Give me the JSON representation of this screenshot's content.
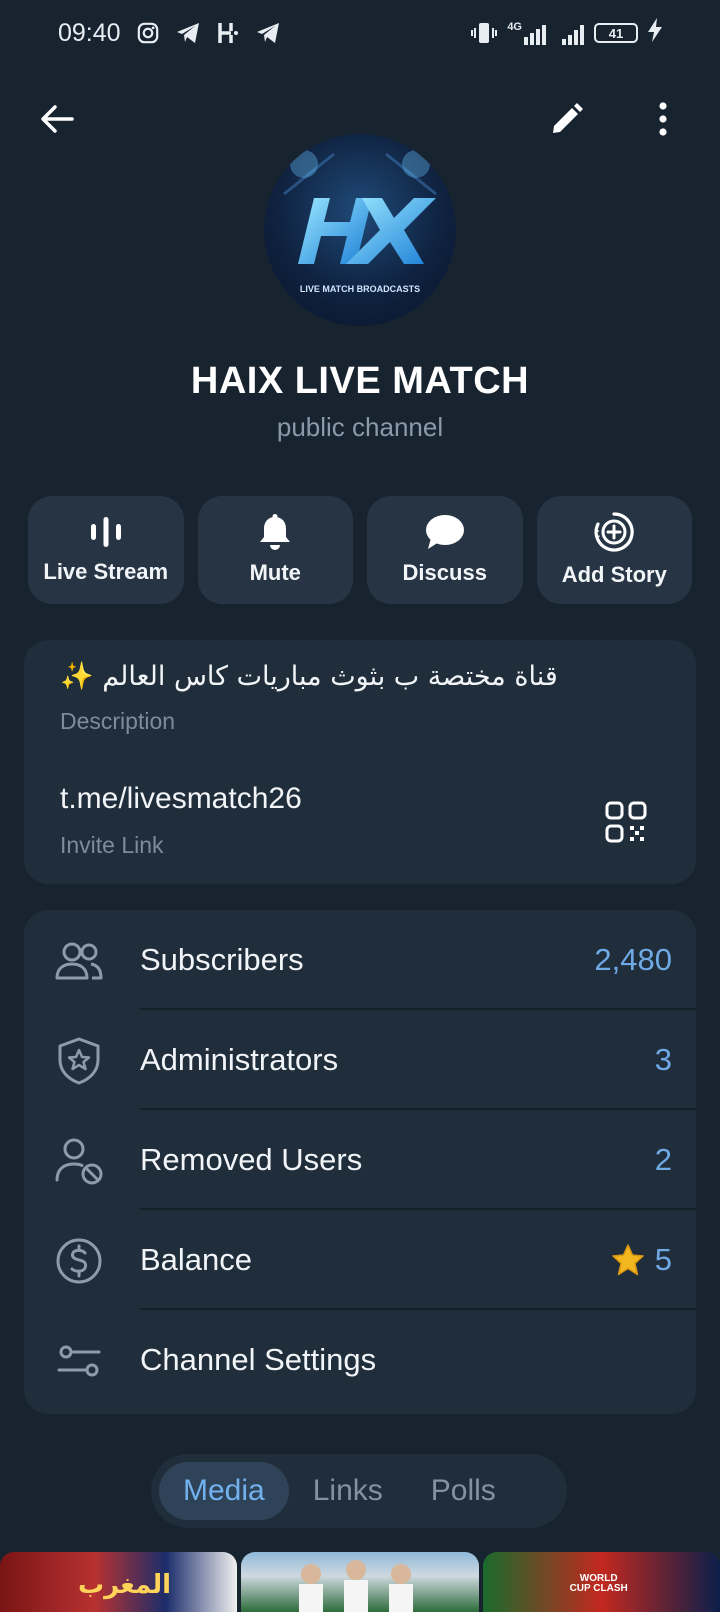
{
  "status": {
    "time": "09:40",
    "network": "4G",
    "battery": "41"
  },
  "channel": {
    "name": "HAIX LIVE MATCH",
    "type": "public channel",
    "avatar_text": "HX",
    "avatar_caption": "LIVE MATCH BROADCASTS"
  },
  "actions": [
    {
      "label": "Live Stream",
      "icon": "live-stream-icon"
    },
    {
      "label": "Mute",
      "icon": "bell-icon"
    },
    {
      "label": "Discuss",
      "icon": "chat-bubble-icon"
    },
    {
      "label": "Add Story",
      "icon": "add-story-icon"
    }
  ],
  "info": {
    "description": "قناة مختصة ب بثوث مباريات كاس العالم ✨",
    "description_label": "Description",
    "link": "t.me/livesmatch26",
    "link_label": "Invite Link"
  },
  "rows": [
    {
      "label": "Subscribers",
      "value": "2,480",
      "icon": "people-icon"
    },
    {
      "label": "Administrators",
      "value": "3",
      "icon": "shield-star-icon"
    },
    {
      "label": "Removed Users",
      "value": "2",
      "icon": "removed-user-icon"
    },
    {
      "label": "Balance",
      "value": "5",
      "icon": "dollar-circle-icon",
      "badge_icon": "star-icon"
    },
    {
      "label": "Channel Settings",
      "value": "",
      "icon": "sliders-icon"
    }
  ],
  "tabs": [
    {
      "label": "Media",
      "active": true
    },
    {
      "label": "Links",
      "active": false
    },
    {
      "label": "Polls",
      "active": false
    }
  ],
  "thumbnails": {
    "t1_text": "المغرب",
    "t3_text": "WORLD CUP CLASH"
  },
  "colors": {
    "background": "#182330",
    "card": "#202d3b",
    "accent": "#6fa9e6",
    "star": "#f2b71f"
  }
}
